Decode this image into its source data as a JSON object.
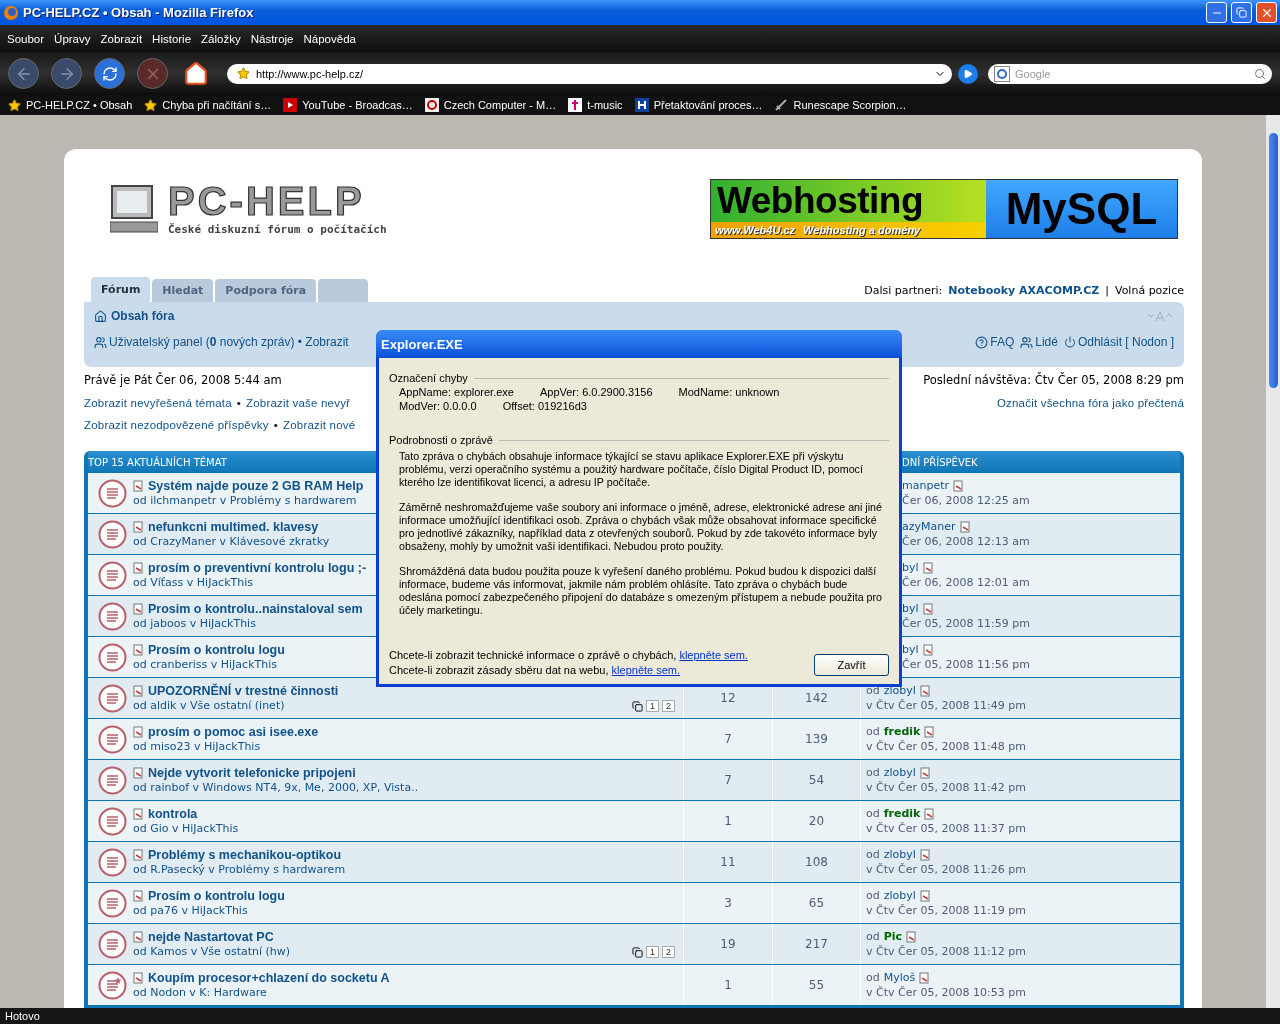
{
  "window": {
    "title": "PC-HELP.CZ • Obsah - Mozilla Firefox"
  },
  "menu": [
    "Soubor",
    "Úpravy",
    "Zobrazit",
    "Historie",
    "Záložky",
    "Nástroje",
    "Nápověda"
  ],
  "toolbar": {
    "address": "http://www.pc-help.cz/",
    "search_placeholder": "Google"
  },
  "bookmarks": [
    {
      "label": "PC-HELP.CZ • Obsah",
      "kind": "star"
    },
    {
      "label": "Chyba při načítání s…",
      "kind": "star"
    },
    {
      "label": "YouTube - Broadcas…",
      "kind": "video"
    },
    {
      "label": "Czech Computer - M…",
      "kind": "cc"
    },
    {
      "label": "t-music",
      "kind": "music"
    },
    {
      "label": "Přetaktování proces…",
      "kind": "h"
    },
    {
      "label": "Runescape Scorpion…",
      "kind": "sword"
    }
  ],
  "forum": {
    "logo": {
      "name": "PC-HELP",
      "tagline": "České diskuzní fórum o počítačích"
    },
    "banner": {
      "headline": "Webhosting",
      "product": "MySQL",
      "site": "www.Web4U.cz",
      "caption": "Webhosting a domény"
    },
    "tabs": [
      {
        "label": "Fórum",
        "selected": true
      },
      {
        "label": "Hledat",
        "selected": false
      },
      {
        "label": "Podpora fóra",
        "selected": false
      }
    ],
    "partners": {
      "label": "Dalsi partneri:",
      "link": "Notebooky AXACOMP.CZ",
      "separator": "|",
      "extra": "Volná pozice"
    },
    "crumb": "Obsah fóra",
    "user_links": "Uživatelský panel (**0** nových zpráv) • Zobrazit",
    "right_links": [
      {
        "label": "FAQ",
        "kind": "help"
      },
      {
        "label": "Lidé",
        "kind": "people"
      },
      {
        "label": "Odhlásit [ Nodon ]",
        "kind": "logout"
      }
    ],
    "time_now": "Právě je Pát Čer 06, 2008 5:44 am",
    "last_visit": "Poslední návštěva: Čtv Čer 05, 2008 8:29 pm",
    "link_rows": [
      {
        "items": [
          "Zobrazit nevyřešená témata",
          "Zobrazit vaše nevyř"
        ],
        "right": "Označit všechna fóra jako přečtená"
      },
      {
        "items": [
          "Zobrazit nezodpovězené příspěvky",
          "Zobrazit nové"
        ]
      }
    ],
    "separator": "•",
    "topics": {
      "header": "TOP 15 AKTUÁLNÍCH TÉMAT",
      "header_last": "DNÍ PŘÍSPĚVEK",
      "rows": [
        {
          "kind": "plain",
          "title": "Systém najde pouze 2 GB RAM Help",
          "by": "od ilchmanpetr v Problémy s hardwarem",
          "last_by": "manpetr",
          "moderator": false,
          "last_time": "Čer 06, 2008 12:25 am"
        },
        {
          "kind": "plain",
          "title": "nefunkcni multimed. klavesy",
          "by": "od CrazyManer v Klávesové zkratky",
          "last_by": "azyManer",
          "moderator": false,
          "last_time": "Čer 06, 2008 12:13 am"
        },
        {
          "kind": "plain",
          "title": "prosím o preventivní kontrolu logu ;-",
          "by": "od Víťass v HiJackThis",
          "last_by": "byl",
          "moderator": false,
          "last_time": "Čer 06, 2008 12:01 am"
        },
        {
          "kind": "plain",
          "title": "Prosim o kontrolu..nainstaloval sem",
          "by": "od jaboos v HiJackThis",
          "last_by": "byl",
          "moderator": false,
          "last_time": "Čer 05, 2008 11:59 pm"
        },
        {
          "kind": "plain",
          "title": "Prosím o kontrolu logu",
          "by": "od cranberiss v HiJackThis",
          "last_by": "byl",
          "moderator": false,
          "last_time": "Čer 05, 2008 11:56 pm"
        },
        {
          "kind": "plain",
          "title": "UPOZORNĚNÍ v trestné činnosti",
          "by": "od aldik v Vše ostatní (inet)",
          "pages": [
            "1",
            "2"
          ],
          "replies": "12",
          "views": "142",
          "last_prefix": "od",
          "last_by": "zlobyl",
          "moderator": false,
          "last_time": "v Čtv Čer 05, 2008 11:49 pm"
        },
        {
          "kind": "plain",
          "title": "prosím o pomoc asi isee.exe",
          "by": "od miso23 v HiJackThis",
          "replies": "7",
          "views": "139",
          "last_prefix": "od",
          "last_by": "fredik",
          "moderator": true,
          "last_time": "v Čtv Čer 05, 2008 11:48 pm"
        },
        {
          "kind": "plain",
          "title": "Nejde vytvorit telefonicke pripojeni",
          "by": "od rainbof v Windows NT4, 9x, Me, 2000, XP, Vista..",
          "replies": "7",
          "views": "54",
          "last_prefix": "od",
          "last_by": "zlobyl",
          "moderator": false,
          "last_time": "v Čtv Čer 05, 2008 11:42 pm"
        },
        {
          "kind": "plain",
          "title": "kontrola",
          "by": "od Gio v HiJackThis",
          "replies": "1",
          "views": "20",
          "last_prefix": "od",
          "last_by": "fredik",
          "moderator": true,
          "last_time": "v Čtv Čer 05, 2008 11:37 pm"
        },
        {
          "kind": "plain",
          "title": "Problémy s mechanikou-optikou",
          "by": "od R.Pasecký v Problémy s hardwarem",
          "replies": "11",
          "views": "108",
          "last_prefix": "od",
          "last_by": "zlobyl",
          "moderator": false,
          "last_time": "v Čtv Čer 05, 2008 11:26 pm"
        },
        {
          "kind": "plain",
          "title": "Prosím o kontrolu logu",
          "by": "od pa76 v HiJackThis",
          "replies": "3",
          "views": "65",
          "last_prefix": "od",
          "last_by": "zlobyl",
          "moderator": false,
          "last_time": "v Čtv Čer 05, 2008 11:19 pm"
        },
        {
          "kind": "plain",
          "title": "nejde Nastartovat PC",
          "by": "od Kamos v Vše ostatní (hw)",
          "pages": [
            "1",
            "2"
          ],
          "replies": "19",
          "views": "217",
          "last_prefix": "od",
          "last_by": "Pic",
          "moderator": true,
          "last_time": "v Čtv Čer 05, 2008 11:12 pm"
        },
        {
          "kind": "starred",
          "title": "Koupím procesor+chlazení do socketu A",
          "by": "od Nodon v K: Hardware",
          "replies": "1",
          "views": "55",
          "last_prefix": "od",
          "last_by": "Myloš",
          "moderator": false,
          "last_time": "v Čtv Čer 05, 2008 10:53 pm"
        }
      ]
    }
  },
  "dialog": {
    "title": "Explorer.EXE",
    "group1": "Označení chyby",
    "fields": [
      [
        "AppName: explorer.exe",
        "AppVer: 6.0.2900.3156",
        "ModName: unknown"
      ],
      [
        "ModVer: 0.0.0.0",
        "Offset: 019216d3"
      ]
    ],
    "group2": "Podrobnosti o zprávě",
    "paragraphs": [
      "Tato zpráva o chybách obsahuje informace týkající se stavu aplikace Explorer.EXE při výskytu problému, verzi operačního systému a použitý hardware počítače, číslo Digital Product ID, pomocí kterého lze identifikovat licenci, a adresu IP počítače.",
      "Záměrně neshromažďujeme vaše soubory ani informace o jméně, adrese, elektronické adrese ani jiné informace umožňující identifikaci osob. Zpráva o chybách však může obsahovat informace specifické pro jednotlivé zákazníky, například data z otevřených souborů. Pokud by zde takovéto informace byly obsaženy, mohly by umožnit vaši identifikaci. Nebudou proto použity.",
      "Shromážděná data budou použita pouze k vyřešení daného problému. Pokud budou k dispozici další informace, budeme vás informovat, jakmile nám problém ohlásíte. Tato zpráva o chybách bude odeslána pomocí zabezpečeného připojení do databáze s omezeným přístupem a nebude použita pro účely marketingu."
    ],
    "links": [
      {
        "text": "Chcete-li zobrazit technické informace o zprávě o chybách,",
        "link": "klepněte sem."
      },
      {
        "text": "Chcete-li zobrazit zásady sběru dat na webu,",
        "link": "klepněte sem."
      }
    ],
    "button": "Zavřít"
  },
  "status_bar": "Hotovo"
}
